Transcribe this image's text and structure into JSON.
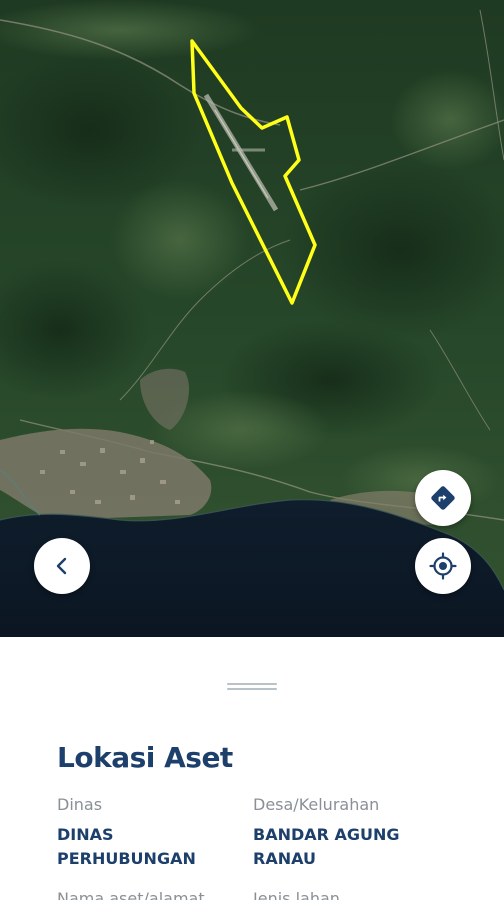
{
  "map": {
    "view": "satellite",
    "boundary_color": "#ffff1a"
  },
  "controls": {
    "back_icon": "chevron-left-icon",
    "directions_icon": "directions-icon",
    "locate_icon": "my-location-icon",
    "icon_color": "#1d3f6b"
  },
  "sheet": {
    "title": "Lokasi Aset",
    "fields": [
      {
        "label": "Dinas",
        "value": "DINAS PERHUBUNGAN"
      },
      {
        "label": "Desa/Kelurahan",
        "value": "BANDAR AGUNG RANAU"
      },
      {
        "label": "Nama aset/alamat",
        "value": ""
      },
      {
        "label": "Jenis lahan",
        "value": ""
      }
    ]
  }
}
